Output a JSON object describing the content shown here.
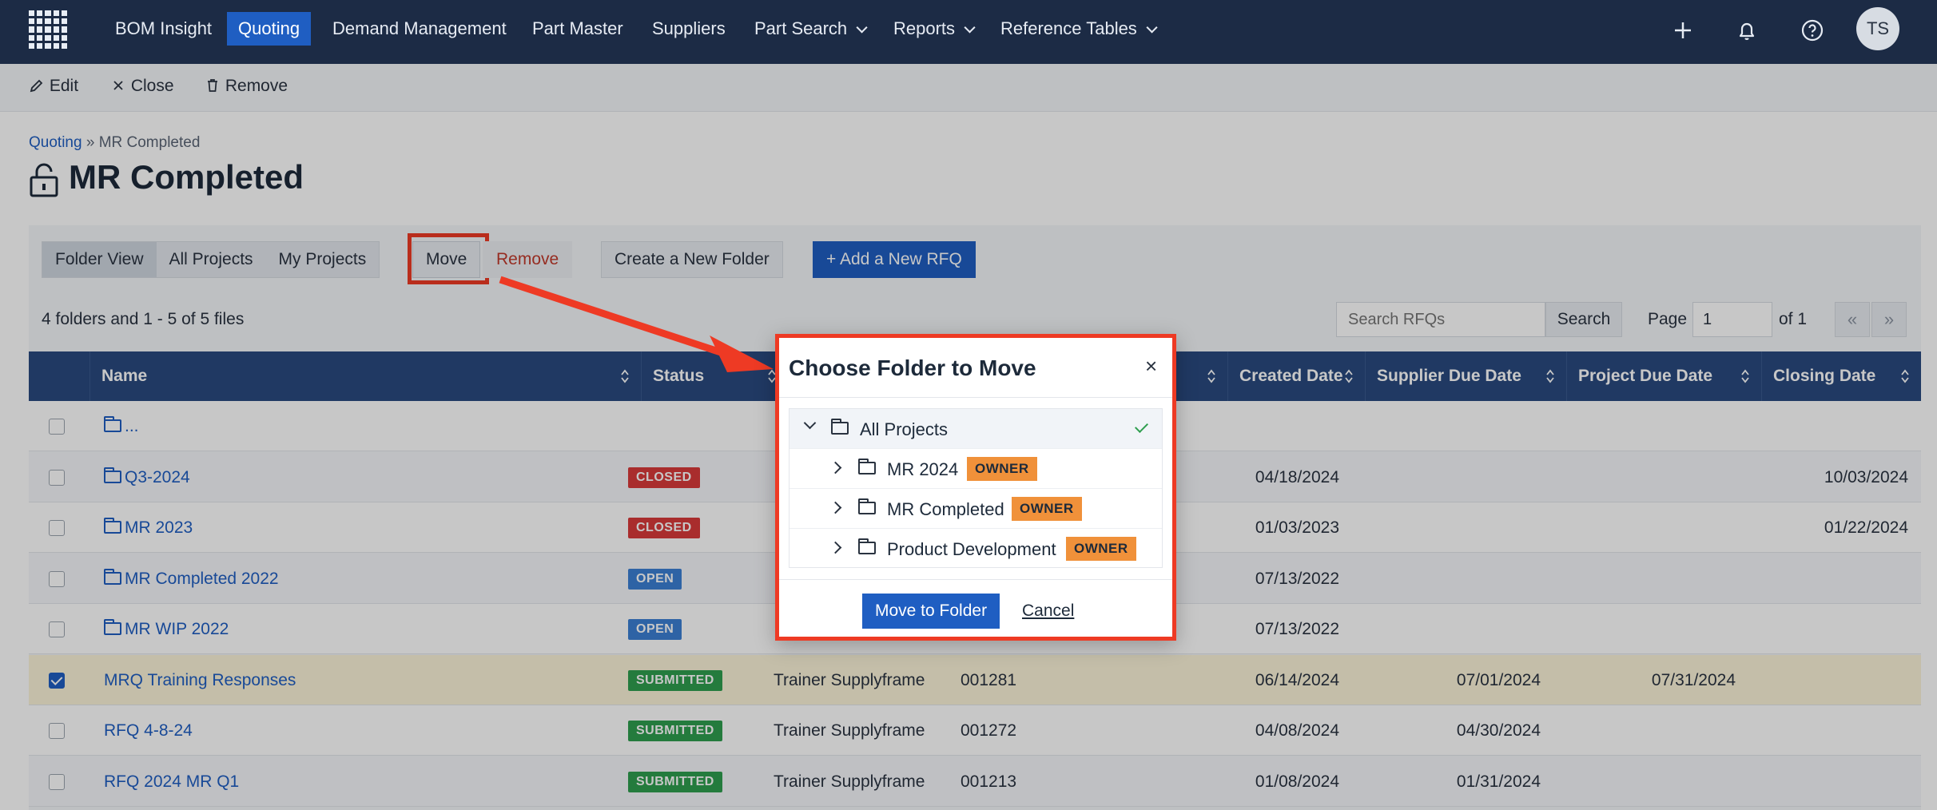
{
  "nav": {
    "items": [
      "BOM Insight",
      "Quoting",
      "Demand Management",
      "Part Master",
      "Suppliers",
      "Part Search",
      "Reports",
      "Reference Tables"
    ],
    "active_index": 1,
    "avatar_initials": "TS",
    "icons": [
      "grid-logo-icon",
      "plus-icon",
      "bell-icon",
      "help-icon"
    ]
  },
  "toolbar": {
    "edit": "Edit",
    "close": "Close",
    "remove": "Remove"
  },
  "breadcrumb": {
    "root": "Quoting",
    "separator": "»",
    "current": "MR Completed"
  },
  "page": {
    "title": "MR Completed"
  },
  "view_buttons": [
    "Folder View",
    "All Projects",
    "My Projects"
  ],
  "actions": {
    "move": "Move",
    "remove": "Remove",
    "create_folder": "Create a New Folder",
    "add_rfq": "+ Add a New RFQ"
  },
  "list": {
    "count_text": "4 folders and 1 - 5 of 5 files",
    "search_placeholder": "Search RFQs",
    "search_button": "Search",
    "page_label": "Page",
    "page_value": "1",
    "of_label": "of 1",
    "prev": "«",
    "next": "»"
  },
  "table": {
    "columns": [
      "Name",
      "Status",
      "",
      "",
      "",
      "Created Date",
      "Supplier Due Date",
      "Project Due Date",
      "Closing Date"
    ],
    "rows": [
      {
        "name": "...",
        "folder": true,
        "status": "",
        "owner": "",
        "num": "",
        "created": "",
        "supplier_due": "",
        "project_due": "",
        "closing": "",
        "checked": false
      },
      {
        "name": "Q3-2024",
        "folder": true,
        "status": "CLOSED",
        "owner": "",
        "num": "",
        "created": "04/18/2024",
        "supplier_due": "",
        "project_due": "",
        "closing": "10/03/2024",
        "checked": false
      },
      {
        "name": "MR 2023",
        "folder": true,
        "status": "CLOSED",
        "owner": "",
        "num": "",
        "created": "01/03/2023",
        "supplier_due": "",
        "project_due": "",
        "closing": "01/22/2024",
        "checked": false
      },
      {
        "name": "MR Completed 2022",
        "folder": true,
        "status": "OPEN",
        "owner": "",
        "num": "",
        "created": "07/13/2022",
        "supplier_due": "",
        "project_due": "",
        "closing": "",
        "checked": false
      },
      {
        "name": "MR WIP 2022",
        "folder": true,
        "status": "OPEN",
        "owner": "",
        "num": "",
        "created": "07/13/2022",
        "supplier_due": "",
        "project_due": "",
        "closing": "",
        "checked": false
      },
      {
        "name": "MRQ Training Responses",
        "folder": false,
        "status": "SUBMITTED",
        "owner": "Trainer Supplyframe",
        "num": "001281",
        "created": "06/14/2024",
        "supplier_due": "07/01/2024",
        "project_due": "07/31/2024",
        "closing": "",
        "checked": true
      },
      {
        "name": "RFQ 4-8-24",
        "folder": false,
        "status": "SUBMITTED",
        "owner": "Trainer Supplyframe",
        "num": "001272",
        "created": "04/08/2024",
        "supplier_due": "04/30/2024",
        "project_due": "",
        "closing": "",
        "checked": false
      },
      {
        "name": "RFQ 2024 MR Q1",
        "folder": false,
        "status": "SUBMITTED",
        "owner": "Trainer Supplyframe",
        "num": "001213",
        "created": "01/08/2024",
        "supplier_due": "01/31/2024",
        "project_due": "",
        "closing": "",
        "checked": false
      }
    ]
  },
  "modal": {
    "title": "Choose Folder to Move",
    "close": "×",
    "tree_root": "All Projects",
    "tree_children": [
      {
        "label": "MR 2024",
        "badge": "OWNER"
      },
      {
        "label": "MR Completed",
        "badge": "OWNER"
      },
      {
        "label": "Product Development",
        "badge": "OWNER"
      }
    ],
    "confirm": "Move to Folder",
    "cancel": "Cancel"
  },
  "colors": {
    "nav_bg": "#1c2b45",
    "accent": "#1f5ec2",
    "highlight": "#ee3a24",
    "owner_badge": "#f0913a"
  }
}
